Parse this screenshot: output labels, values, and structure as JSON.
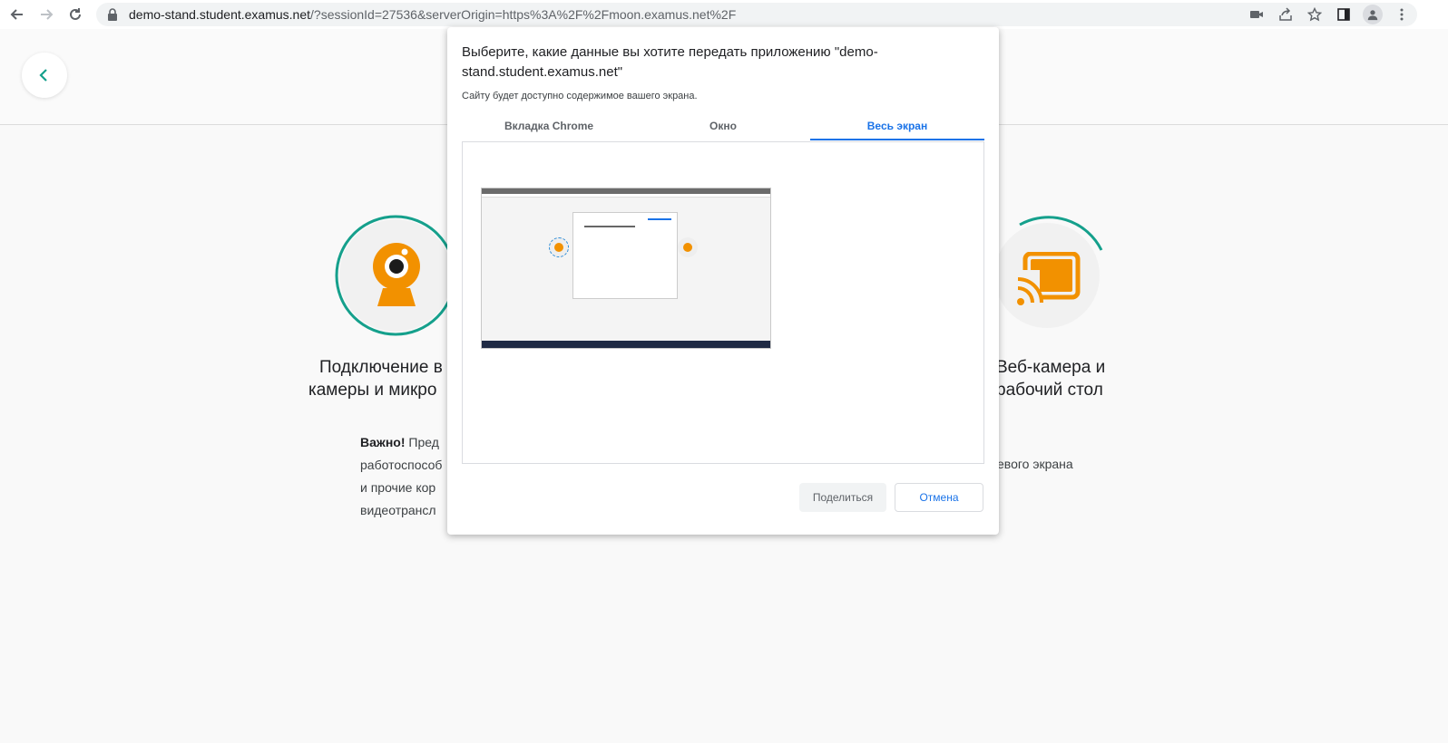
{
  "browser": {
    "url_host": "demo-stand.student.examus.net",
    "url_path": "/?sessionId=27536&serverOrigin=https%3A%2F%2Fmoon.examus.net%2F"
  },
  "page": {
    "steps": [
      {
        "title_line1": "Подключение в",
        "title_line2": "камеры и микро"
      },
      {
        "title_line1": "Веб-камера и",
        "title_line2": "рабочий стол"
      }
    ],
    "important_label": "Важно!",
    "important_lines": [
      "Пред",
      "работоспособ",
      "и прочие кор",
      "видеотрансл"
    ],
    "right_fragment": "евого экрана"
  },
  "dialog": {
    "title": "Выберите, какие данные вы хотите передать приложению \"demo-stand.student.examus.net\"",
    "subtitle": "Сайту будет доступно содержимое вашего экрана.",
    "tabs": [
      {
        "label": "Вкладка Chrome"
      },
      {
        "label": "Окно"
      },
      {
        "label": "Весь экран"
      }
    ],
    "active_tab": "Весь экран",
    "share_label": "Поделиться",
    "cancel_label": "Отмена"
  },
  "colors": {
    "accent": "#1a73e8",
    "teal": "#15a08c",
    "orange": "#f29100"
  }
}
